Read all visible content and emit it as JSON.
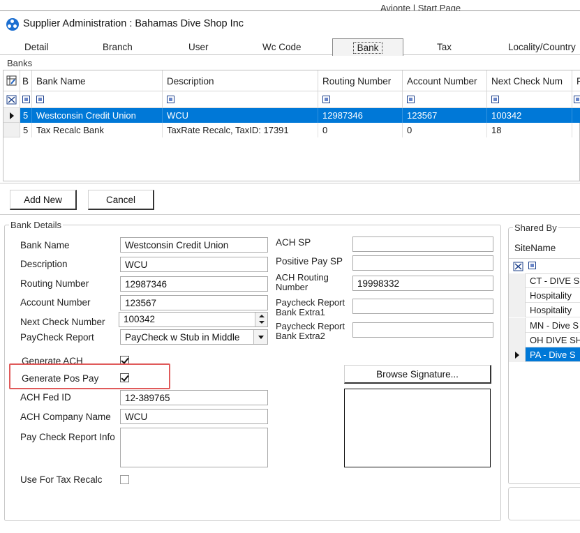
{
  "topbar": {
    "text": "Avionte | Start Page"
  },
  "window": {
    "title": "Supplier Administration : Bahamas Dive Shop Inc"
  },
  "tabs": [
    {
      "label": "Detail"
    },
    {
      "label": "Branch"
    },
    {
      "label": "User"
    },
    {
      "label": "Wc Code"
    },
    {
      "label": "Bank"
    },
    {
      "label": "Tax"
    },
    {
      "label": "Locality/Country"
    }
  ],
  "active_tab": "Bank",
  "banks": {
    "section_label": "Banks",
    "columns": [
      "B",
      "Bank Name",
      "Description",
      "Routing Number",
      "Account Number",
      "Next Check Num",
      "P"
    ],
    "rows": [
      {
        "b": "5",
        "bank_name": "Westconsin Credit Union",
        "description": "WCU",
        "routing": "12987346",
        "account": "123567",
        "next_check": "100342",
        "selected": true
      },
      {
        "b": "5",
        "bank_name": "Tax Recalc Bank",
        "description": "TaxRate Recalc, TaxID: 17391",
        "routing": "0",
        "account": "0",
        "next_check": "18",
        "selected": false
      }
    ]
  },
  "buttons": {
    "add_new": "Add New",
    "cancel": "Cancel",
    "browse_signature": "Browse Signature..."
  },
  "bank_details": {
    "section_label": "Bank Details",
    "bank_name_label": "Bank Name",
    "bank_name": "Westconsin Credit Union",
    "description_label": "Description",
    "description": "WCU",
    "routing_label": "Routing Number",
    "routing": "12987346",
    "account_label": "Account Number",
    "account": "123567",
    "next_check_label": "Next Check Number",
    "next_check": "100342",
    "paycheck_report_label": "PayCheck Report",
    "paycheck_report": "PayCheck w Stub in Middle",
    "generate_ach_label": "Generate ACH",
    "generate_ach": true,
    "generate_pos_pay_label": "Generate Pos Pay",
    "generate_pos_pay": true,
    "ach_fed_id_label": "ACH Fed ID",
    "ach_fed_id": "12-389765",
    "ach_company_label": "ACH Company Name",
    "ach_company": "WCU",
    "pay_check_info_label": "Pay Check Report Info",
    "pay_check_info": "",
    "use_tax_recalc_label": "Use For Tax Recalc",
    "use_tax_recalc": false,
    "ach_sp_label": "ACH SP",
    "ach_sp": "",
    "positive_pay_sp_label": "Positive Pay SP",
    "positive_pay_sp": "",
    "ach_routing_label_1": "ACH Routing",
    "ach_routing_label_2": "Number",
    "ach_routing": "19998332",
    "extra1_label_1": "Paycheck Report",
    "extra1_label_2": "Bank Extra1",
    "extra1": "",
    "extra2_label_1": "Paycheck Report",
    "extra2_label_2": "Bank Extra2",
    "extra2": ""
  },
  "shared_by": {
    "section_label": "Shared By",
    "column": "SiteName",
    "rows": [
      {
        "name": "CT - DIVE S",
        "selected": false
      },
      {
        "name": "Hospitality",
        "selected": false
      },
      {
        "name": "Hospitality",
        "selected": false
      },
      {
        "name": "MN - Dive S",
        "selected": false
      },
      {
        "name": "OH DIVE SH",
        "selected": false
      },
      {
        "name": "PA - Dive S",
        "selected": true
      }
    ]
  },
  "colors": {
    "selection": "#0078d7",
    "highlight": "#e05a5a",
    "icon_blue": "#1c6fd1"
  }
}
